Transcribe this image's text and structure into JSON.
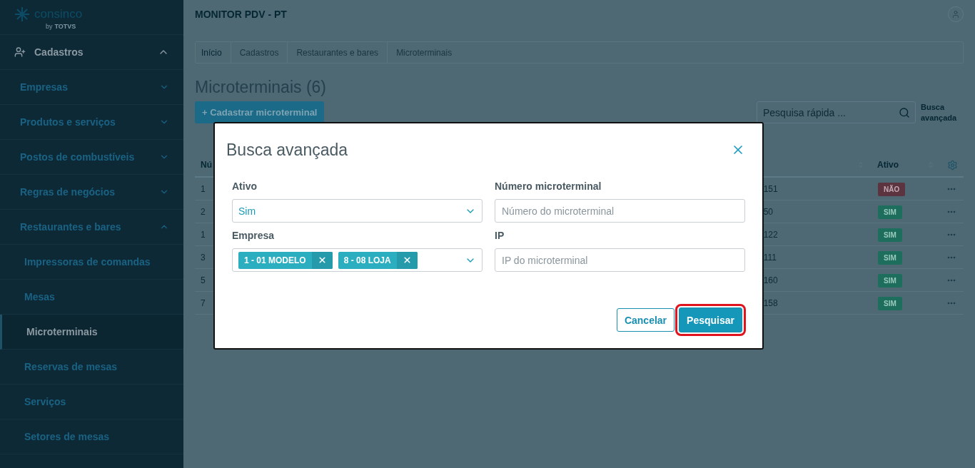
{
  "sidebar": {
    "logo": {
      "name": "consinco",
      "byline": "by",
      "brand": "TOTVS"
    },
    "section": {
      "label": "Cadastros",
      "expanded": true,
      "items": [
        {
          "label": "Empresas",
          "expanded": false
        },
        {
          "label": "Produtos e serviços",
          "expanded": false
        },
        {
          "label": "Postos de combustíveis",
          "expanded": false
        },
        {
          "label": "Regras de negócios",
          "expanded": false
        },
        {
          "label": "Restaurantes e bares",
          "expanded": true,
          "children": [
            {
              "label": "Impressoras de comandas",
              "selected": false
            },
            {
              "label": "Mesas",
              "selected": false
            },
            {
              "label": "Microterminais",
              "selected": true
            },
            {
              "label": "Reservas de mesas",
              "selected": false
            },
            {
              "label": "Serviços",
              "selected": false
            },
            {
              "label": "Setores de mesas",
              "selected": false
            }
          ]
        }
      ]
    }
  },
  "header": {
    "title": "MONITOR PDV - PT"
  },
  "breadcrumb": [
    "Início",
    "Cadastros",
    "Restaurantes e bares",
    "Microterminais"
  ],
  "page": {
    "title": "Microterminais (6)",
    "add_button": "+ Cadastrar microterminal",
    "search": {
      "placeholder": "Pesquisa rápida ..."
    },
    "advanced_link": "Busca avançada"
  },
  "table": {
    "columns": [
      "Nú",
      "Ativo"
    ],
    "rows": [
      {
        "column_1": "1",
        "column_3": "151",
        "active": {
          "label": "NÃO",
          "on": false
        }
      },
      {
        "column_1": "2",
        "column_3": "50",
        "active": {
          "label": "SIM",
          "on": true
        }
      },
      {
        "column_1": "1",
        "column_3": "122",
        "active": {
          "label": "SIM",
          "on": true
        }
      },
      {
        "column_1": "3",
        "column_3": "111",
        "active": {
          "label": "SIM",
          "on": true
        }
      },
      {
        "column_1": "5",
        "column_3": "160",
        "active": {
          "label": "SIM",
          "on": true
        }
      },
      {
        "column_1": "7",
        "column_3": "158",
        "active": {
          "label": "SIM",
          "on": true
        }
      }
    ]
  },
  "dialog": {
    "title": "Busca avançada",
    "fields": [
      {
        "kind": "select",
        "label": "Ativo",
        "value": "Sim"
      },
      {
        "kind": "input",
        "label": "Número microterminal",
        "placeholder": "Número do microterminal"
      },
      {
        "kind": "multiselect",
        "label": "Empresa",
        "chips": [
          "1 - 01 MODELO",
          "8 - 08 LOJA"
        ]
      },
      {
        "kind": "input",
        "label": "IP",
        "placeholder": "IP do microterminal"
      }
    ],
    "buttons": [
      {
        "label": "Cancelar",
        "kind": "secondary",
        "highlighted": false
      },
      {
        "label": "Pesquisar",
        "kind": "primary",
        "highlighted": true
      }
    ]
  }
}
